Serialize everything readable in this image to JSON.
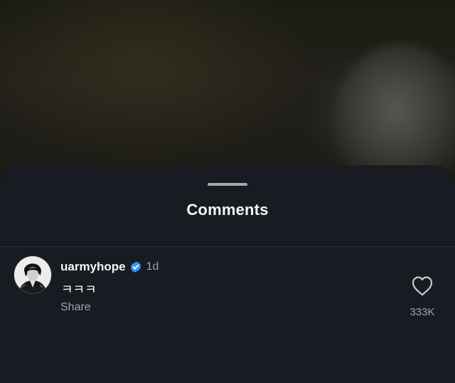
{
  "sheet": {
    "title": "Comments"
  },
  "comment": {
    "username": "uarmyhope",
    "time": "1d",
    "text": "ㅋㅋㅋ",
    "share_label": "Share",
    "like_count": "333K",
    "verified": true
  },
  "icons": {
    "verified": "verified-badge-icon",
    "like": "heart-outline-icon"
  },
  "colors": {
    "sheet_bg": "#181c22",
    "text_primary": "#f4f5f7",
    "text_secondary": "#a0a5ac",
    "verified_blue": "#3897f0"
  }
}
